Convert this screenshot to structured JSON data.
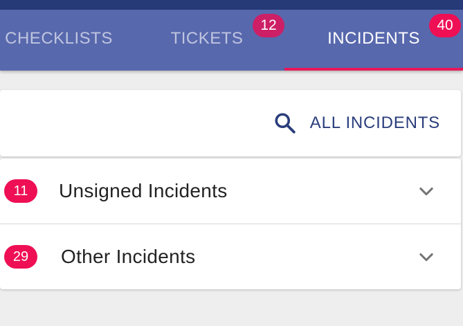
{
  "tabs": [
    {
      "label": "CHECKLISTS",
      "badge": null,
      "active": false
    },
    {
      "label": "TICKETS",
      "badge": "12",
      "active": false
    },
    {
      "label": "INCIDENTS",
      "badge": "40",
      "active": true
    }
  ],
  "search": {
    "icon": "search-icon",
    "label": "ALL INCIDENTS"
  },
  "sections": [
    {
      "count": "11",
      "title": "Unsigned Incidents",
      "icon": "chevron-down-icon"
    },
    {
      "count": "29",
      "title": "Other Incidents",
      "icon": "chevron-down-icon"
    }
  ],
  "colors": {
    "status_bar": "#263a78",
    "tab_bar": "#5868ad",
    "indicator": "#e8185a",
    "badge": "#ee0f55",
    "badge_muted": "#cc1f66",
    "link": "#2a3d7c",
    "background": "#eeeeee"
  }
}
